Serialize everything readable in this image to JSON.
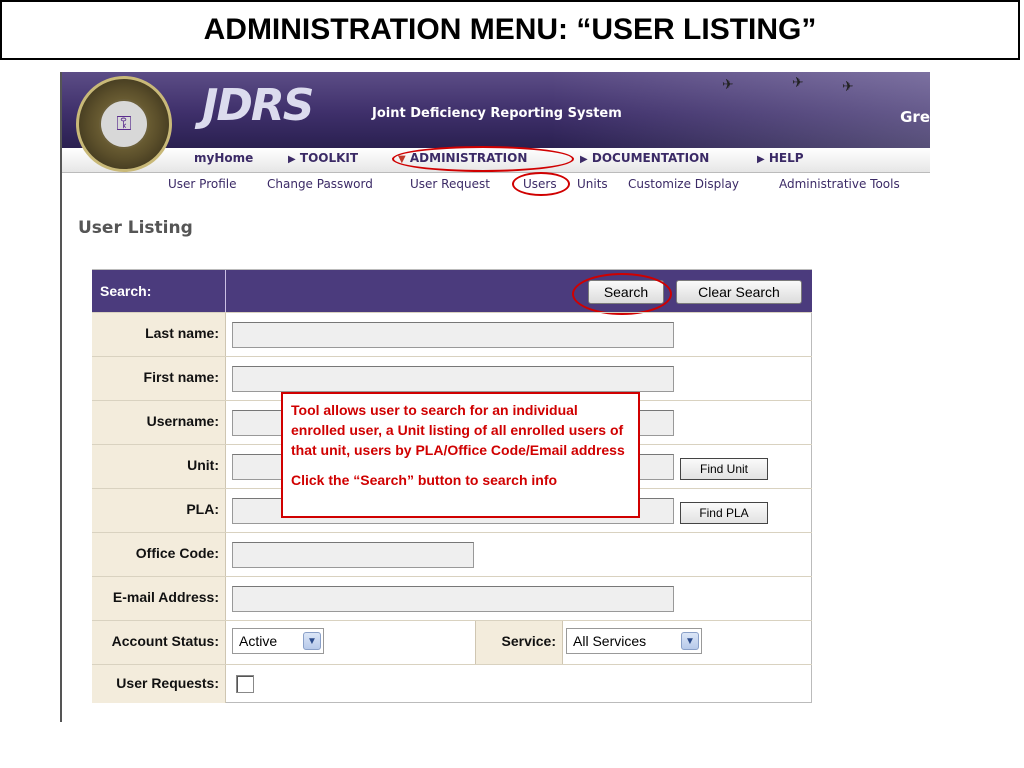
{
  "slide": {
    "title": "ADMINISTRATION MENU: “USER LISTING”"
  },
  "header": {
    "logo_text": "JDRS",
    "subtitle": "Joint Deficiency Reporting System",
    "right_text": "Gre"
  },
  "nav": {
    "items": [
      {
        "label": "myHome",
        "arrow": ""
      },
      {
        "label": "TOOLKIT",
        "arrow": "▶"
      },
      {
        "label": "ADMINISTRATION",
        "arrow": "▼"
      },
      {
        "label": "DOCUMENTATION",
        "arrow": "▶"
      },
      {
        "label": "HELP",
        "arrow": "▶"
      }
    ],
    "active": "ADMINISTRATION"
  },
  "subnav": {
    "items": [
      "User Profile",
      "Change Password",
      "User Request",
      "Users",
      "Units",
      "Customize Display",
      "Administrative Tools"
    ],
    "active": "Users"
  },
  "page": {
    "heading": "User Listing"
  },
  "form": {
    "header_label": "Search:",
    "search_button": "Search",
    "clear_button": "Clear Search",
    "labels": {
      "last_name": "Last name:",
      "first_name": "First name:",
      "username": "Username:",
      "unit": "Unit:",
      "pla": "PLA:",
      "office_code": "Office Code:",
      "email": "E-mail Address:",
      "account_status": "Account Status:",
      "service": "Service:",
      "user_requests": "User Requests:"
    },
    "values": {
      "last_name": "",
      "first_name": "",
      "username": "",
      "unit": "",
      "pla": "",
      "office_code": "",
      "email": "",
      "account_status": "Active",
      "service": "All Services"
    },
    "find_unit_button": "Find Unit",
    "find_pla_button": "Find PLA",
    "user_requests_checked": false
  },
  "callout": {
    "line1": "Tool allows user to search for an individual enrolled user, a Unit listing of all enrolled users of that unit, users by PLA/Office Code/Email address",
    "line2": "Click the “Search” button to search info"
  },
  "colors": {
    "banner": "#3e2f6a",
    "form_header": "#4b3b7d",
    "annotation": "#d00000",
    "label_bg": "#f3ecdc"
  }
}
